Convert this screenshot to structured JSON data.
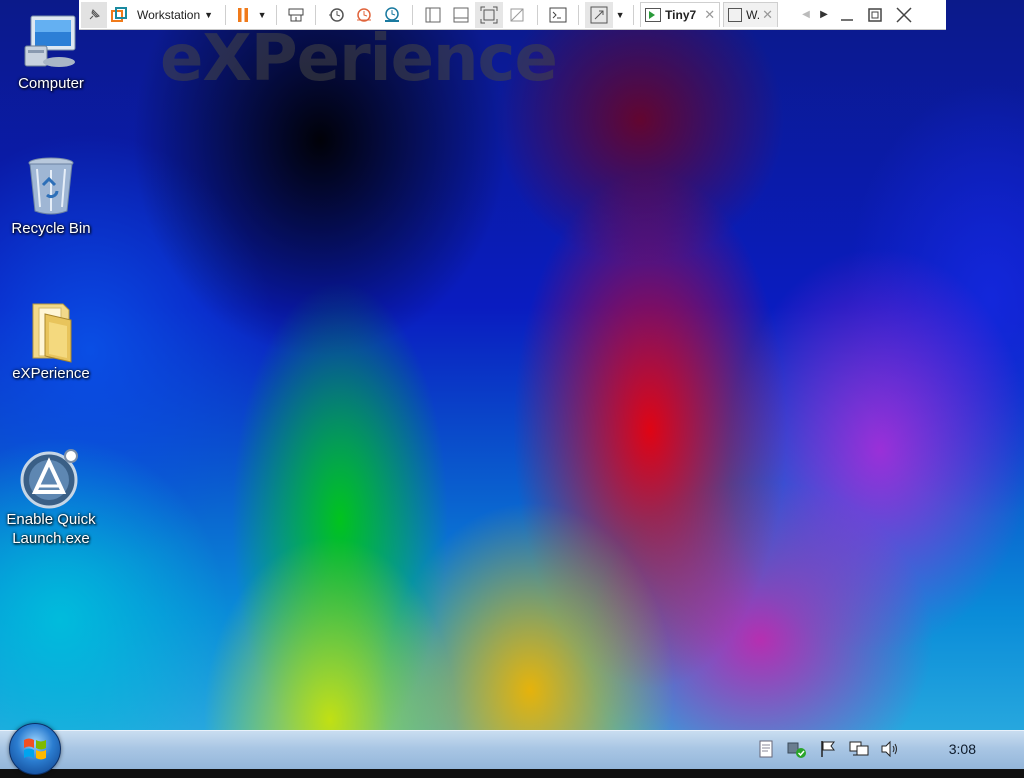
{
  "desktop": {
    "watermark": "eXPerience",
    "icons": [
      {
        "label": "Computer",
        "icon": "computer-icon"
      },
      {
        "label": "Recycle Bin",
        "icon": "recycle-bin-icon"
      },
      {
        "label": "eXPerience",
        "icon": "folder-icon"
      },
      {
        "label": "Enable Quick Launch.exe",
        "icon": "app-launcher-icon"
      }
    ]
  },
  "toolbar": {
    "menu_label": "Workstation",
    "tabs": [
      {
        "label": "Tiny7",
        "active": true
      },
      {
        "label": "W.",
        "active": false
      }
    ],
    "icons": [
      "pin-icon",
      "vmware-icon",
      "pause-icon",
      "send-ctrl-alt-del-icon",
      "snapshot-icon",
      "revert-snapshot-icon",
      "snapshot-manager-icon",
      "console-icon",
      "fullscreen-icon",
      "unity-icon",
      "terminal-icon",
      "stretch-icon"
    ]
  },
  "taskbar": {
    "clock": "3:08",
    "tray_icons": [
      "notes-icon",
      "security-shield-icon",
      "action-center-flag-icon",
      "network-icon",
      "volume-icon"
    ]
  },
  "colors": {
    "taskbar_top": "#c9ddf0",
    "taskbar_bottom": "#94b6da",
    "orange_accent": "#f07a1a",
    "teal_accent": "#1a8aa0"
  }
}
